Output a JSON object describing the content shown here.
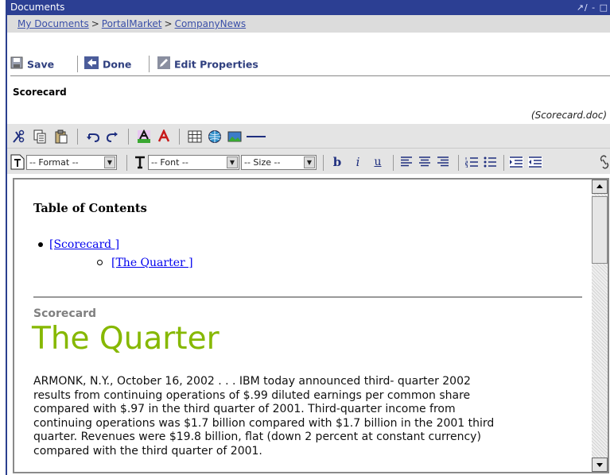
{
  "window": {
    "title": "Documents",
    "controls_text": "↗∕ - □"
  },
  "breadcrumb": {
    "items": [
      "My Documents",
      "PortalMarket",
      "CompanyNews"
    ],
    "separator": ">"
  },
  "actions": {
    "save": "Save",
    "done": "Done",
    "edit_properties": "Edit Properties"
  },
  "document": {
    "title": "Scorecard",
    "filename": "(Scorecard.doc)"
  },
  "toolbar": {
    "icons_row1": [
      "cut-icon",
      "copy-icon",
      "paste-icon",
      "undo-icon",
      "redo-icon",
      "highlight-color-icon",
      "font-color-icon",
      "table-icon",
      "web-link-icon",
      "image-icon",
      "horizontal-rule-icon"
    ],
    "format_select": "-- Format --",
    "font_select": "-- Font --",
    "size_select": "-- Size --",
    "bold": "b",
    "italic": "i",
    "underline": "u"
  },
  "editor": {
    "toc_heading": "Table of Contents",
    "toc_items": [
      {
        "label": "[Scorecard ]",
        "level": 1
      },
      {
        "label": "[The Quarter ]",
        "level": 2
      }
    ],
    "section_label": "Scorecard",
    "headline": "The Quarter",
    "body_lines": [
      "ARMONK, N.Y., October 16, 2002 . . . IBM today announced third- quarter 2002",
      "results from continuing operations of $.99 diluted earnings per common share",
      "compared with $.97 in the third quarter of 2001. Third-quarter income from",
      "continuing operations was $1.7 billion compared with $1.7 billion in the 2001 third",
      "quarter. Revenues were $19.8 billion, flat (down 2 percent at constant currency)",
      "compared with the third quarter of 2001."
    ]
  },
  "colors": {
    "titlebar": "#2c3f93",
    "headline": "#86b800",
    "link": "#0000ee",
    "action_text": "#2f3f7f"
  }
}
